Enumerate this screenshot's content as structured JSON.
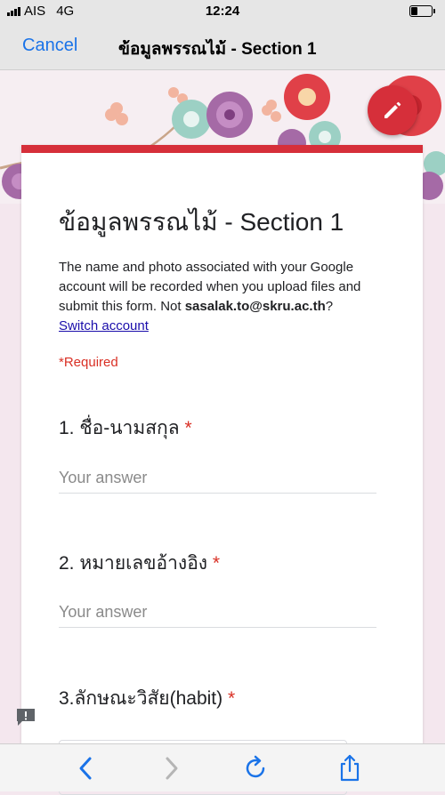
{
  "status_bar": {
    "carrier": "AIS",
    "network": "4G",
    "time": "12:24",
    "battery_level": 0.3
  },
  "nav": {
    "cancel_label": "Cancel",
    "title": "ข้อมูลพรรณไม้ - Section 1"
  },
  "form": {
    "title": "ข้อมูลพรรณไม้ - Section 1",
    "notice_text": "The name and photo associated with your Google account will be recorded when you upload files and submit this form. Not ",
    "account_email": "sasalak.to@skru.ac.th",
    "notice_suffix": "?",
    "switch_account_label": "Switch account",
    "required_label": "*Required",
    "accent_color": "#d62f3a",
    "questions": [
      {
        "label": "1. ชื่อ-นามสกุล",
        "required_mark": "*",
        "placeholder": "Your answer"
      },
      {
        "label": "2. หมายเลขอ้างอิง",
        "required_mark": "*",
        "placeholder": "Your answer"
      },
      {
        "label": "3.ลักษณะวิสัย(habit)",
        "required_mark": "*"
      }
    ]
  },
  "icons": {
    "edit": "pencil-icon",
    "feedback": "feedback-icon",
    "back": "chevron-left-icon",
    "forward": "chevron-right-icon",
    "reload": "reload-icon",
    "share": "share-icon"
  }
}
